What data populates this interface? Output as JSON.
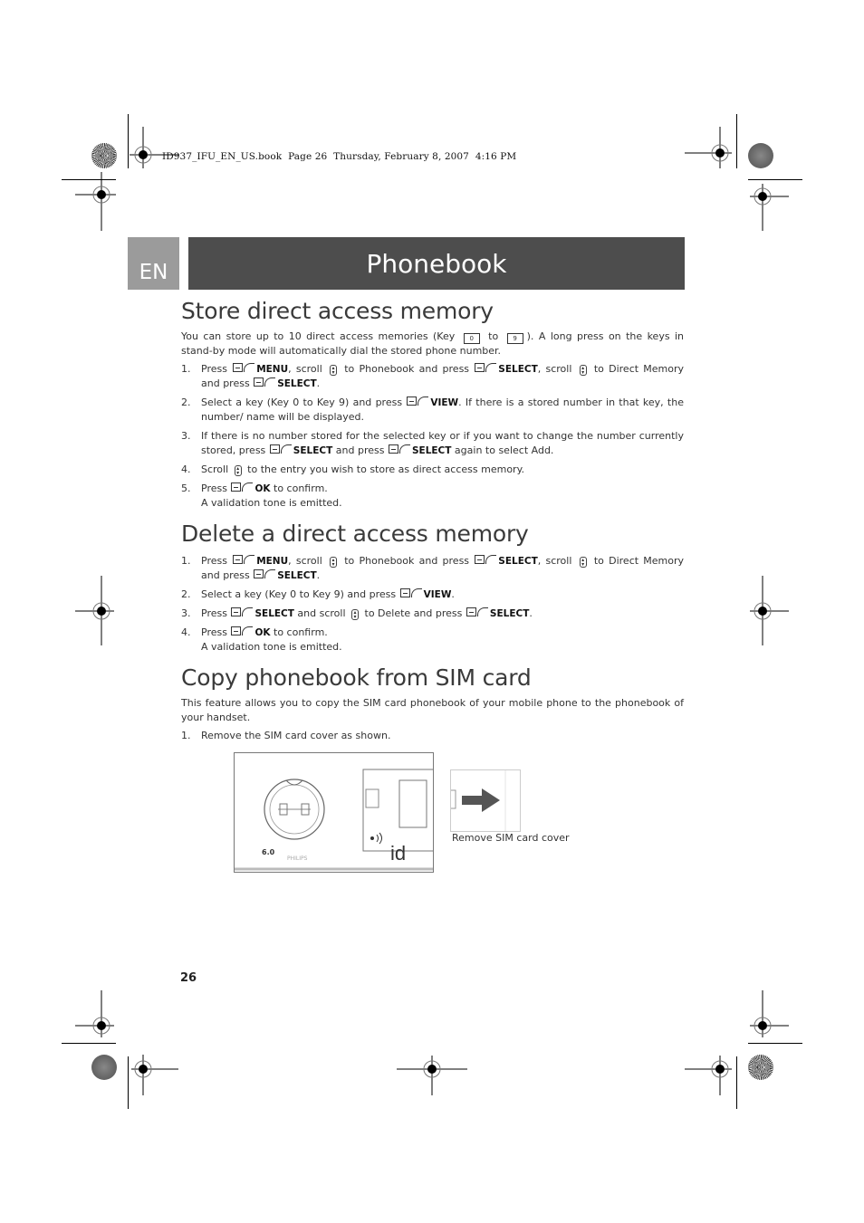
{
  "slug": "ID937_IFU_EN_US.book  Page 26  Thursday, February 8, 2007  4:16 PM",
  "header": {
    "lang_tab": "EN",
    "title": "Phonebook"
  },
  "sections": [
    {
      "heading": "Store direct access memory",
      "intro": {
        "before": "You can store up to 10 direct access memories (Key",
        "key_from": "0",
        "middle": "to",
        "key_to": "9",
        "after": "). A long press on the keys in stand-by mode will automatically dial the stored phone number."
      },
      "steps": [
        {
          "num": "1.",
          "parts": [
            "Press",
            "MENU",
            ", scroll",
            "to Phonebook and press",
            "SELECT",
            ", scroll",
            "to Direct Memory and press",
            "SELECT",
            "."
          ]
        },
        {
          "num": "2.",
          "parts": [
            "Select a key (Key 0 to Key 9) and press",
            "VIEW",
            ". If there is a stored number in that key, the number/ name will be displayed."
          ]
        },
        {
          "num": "3.",
          "parts": [
            "If there is no number stored for the selected key or if you want to change the number currently stored, press",
            "SELECT",
            "and press",
            "SELECT",
            "again to select Add."
          ]
        },
        {
          "num": "4.",
          "parts": [
            "Scroll",
            "to the entry you wish to store as direct access memory."
          ]
        },
        {
          "num": "5.",
          "parts": [
            "Press",
            "OK",
            "to confirm."
          ],
          "note": "A validation tone is emitted."
        }
      ]
    },
    {
      "heading": "Delete a direct access memory",
      "steps": [
        {
          "num": "1.",
          "parts": [
            "Press",
            "MENU",
            ", scroll",
            "to Phonebook and press",
            "SELECT",
            ", scroll",
            "to Direct Memory and press",
            "SELECT",
            "."
          ]
        },
        {
          "num": "2.",
          "parts": [
            "Select a key (Key 0 to Key 9) and press",
            "VIEW",
            "."
          ]
        },
        {
          "num": "3.",
          "parts": [
            "Press",
            "SELECT",
            "and scroll",
            "to Delete and press",
            "SELECT",
            "."
          ]
        },
        {
          "num": "4.",
          "parts": [
            "Press",
            "OK",
            "to confirm."
          ],
          "note": "A validation tone is emitted."
        }
      ]
    },
    {
      "heading": "Copy phonebook from SIM card",
      "intro_text": "This feature allows you to copy the SIM card phonebook of your mobile phone to the phonebook of your handset.",
      "steps": [
        {
          "num": "1.",
          "parts": [
            "Remove the SIM card cover as shown."
          ]
        }
      ]
    }
  ],
  "illustration": {
    "caption": "Remove SIM card cover",
    "logo_text": "PHILIPS",
    "badge_text": "6.0",
    "sensor_label": "handset locator",
    "brand_mark": "ID"
  },
  "page_number": "26",
  "icons": {
    "softkey": "left-softkey-icon",
    "scroll": "scroll-updown-icon",
    "key": "keypad-key-icon"
  }
}
